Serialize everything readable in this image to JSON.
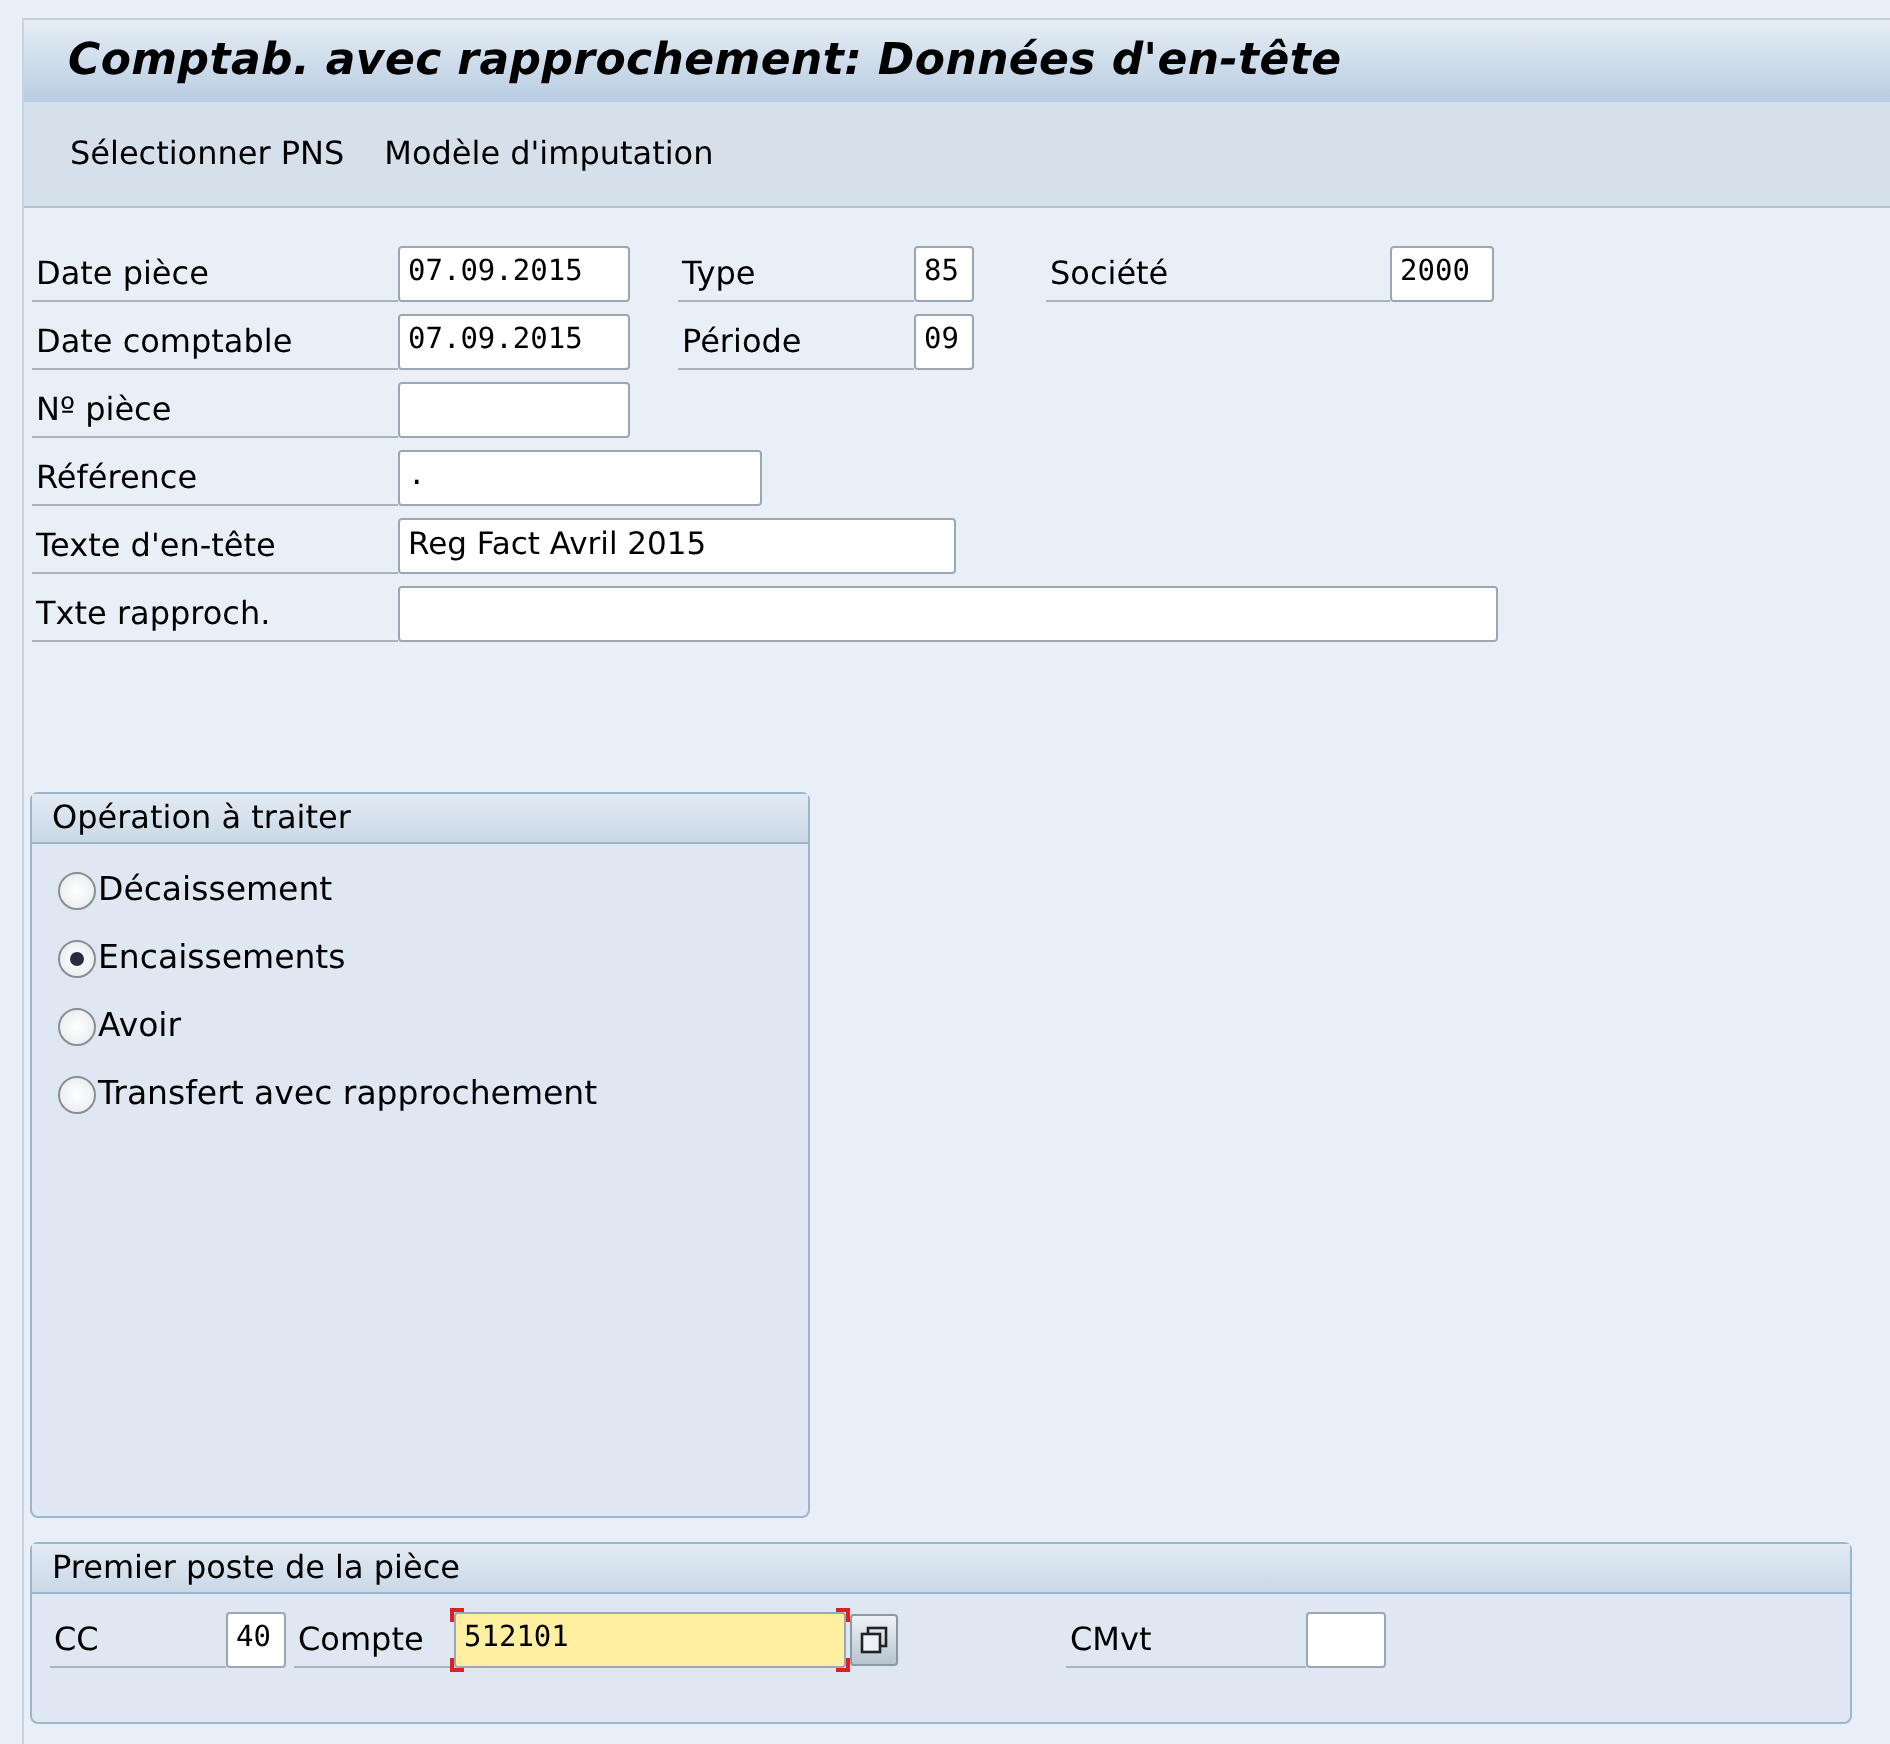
{
  "window": {
    "title": "Comptab. avec rapprochement: Données d'en-tête"
  },
  "toolbar": [
    "Sélectionner PNS",
    "Modèle d'imputation"
  ],
  "header_rows": [
    [
      {
        "label": "Date pièce",
        "value": "07.09.2015"
      },
      {
        "label": "Type",
        "value": "85"
      },
      {
        "label": "Société",
        "value": "2000"
      }
    ],
    [
      {
        "label": "Date comptable",
        "value": "07.09.2015"
      },
      {
        "label": "Période",
        "value": "09"
      }
    ],
    [
      {
        "label": "Nº pièce"
      }
    ],
    [
      {
        "label": "Référence",
        "value": "."
      }
    ],
    [
      {
        "label": "Texte d'en-tête",
        "value": "Reg Fact Avril 2015"
      }
    ],
    [
      {
        "label": "Txte rapproch."
      }
    ]
  ],
  "operation_group": {
    "title": "Opération à traiter",
    "options": [
      {
        "label": "Décaissement",
        "selected": false
      },
      {
        "label": "Encaissements",
        "selected": true
      },
      {
        "label": "Avoir",
        "selected": false
      },
      {
        "label": "Transfert avec rapprochement",
        "selected": false
      }
    ]
  },
  "first_item_group": {
    "title": "Premier poste de la pièce",
    "fields": [
      {
        "label": "CC",
        "value": "40",
        "focused": false
      },
      {
        "label": "Compte",
        "value": "512101",
        "focused": true
      },
      {
        "label": "CMvt",
        "focused": false
      }
    ]
  }
}
